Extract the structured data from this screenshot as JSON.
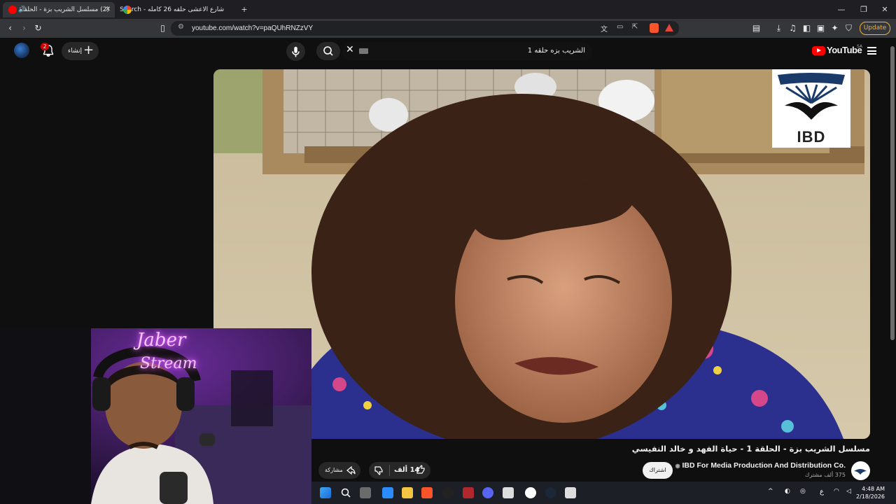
{
  "browser": {
    "tabs": [
      {
        "title": "(2) مسلسل الشريب بزة - الحلقة",
        "active": true
      },
      {
        "title": "شارع الاعشى حلقه 26 كامله - Search",
        "active": false
      }
    ],
    "new_tab": "+",
    "url": "youtube.com/watch?v=paQUhRNZzVY",
    "update_label": "Update",
    "window_controls": [
      "—",
      "❐",
      "✕"
    ]
  },
  "youtube": {
    "logo_word": "YouTube",
    "country_code": "SA",
    "search_query": "الشريب بزه حلقه 1",
    "create_label": "إنشاء",
    "notification_count": "2"
  },
  "player": {
    "watermark": "IBD"
  },
  "video": {
    "title": "مسلسل الشريب بزة - الحلقة 1 - حياة الفهد و خالد النفيسي",
    "channel_name": "IBD For Media Production And Distribution Co.",
    "subscribers": "375 ألف مشترك",
    "subscribe_label": "اشتراك",
    "likes": "14 ألف",
    "share_label": "مشاركة"
  },
  "webcam": {
    "neon_line1": "Jaber",
    "neon_line2": "Stream"
  },
  "taskbar": {
    "time": "4:48 AM",
    "date": "2/18/2026",
    "lang": "ع"
  },
  "colors": {
    "brand_red": "#ff0000",
    "update_orange": "#f0b43a",
    "neon_pink": "#e05cff"
  }
}
